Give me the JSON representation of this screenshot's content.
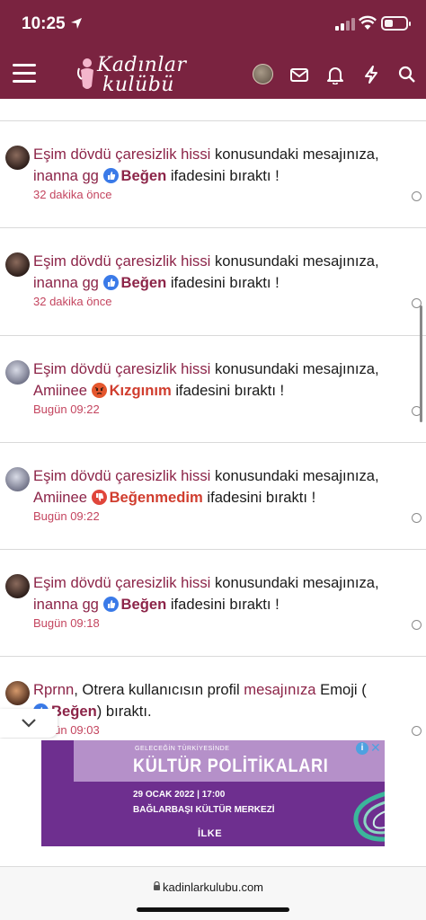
{
  "status_bar": {
    "time": "10:25"
  },
  "header": {
    "logo_line1": "Kadınlar",
    "logo_line2": "kulübü",
    "icons": [
      "menu-icon",
      "user-avatar",
      "mail-icon",
      "bell-icon",
      "bolt-icon",
      "search-icon"
    ],
    "brand_color": "#7a2340"
  },
  "notifications": [
    {
      "thread": "Eşim dövdü çaresizlik hissi",
      "mid": " konusundaki mesajınıza,",
      "user": "inanna gg",
      "reaction": "Beğen",
      "reaction_type": "like",
      "tail": " ifadesini bıraktı !",
      "time": "32 dakika önce"
    },
    {
      "thread": "Eşim dövdü çaresizlik hissi",
      "mid": " konusundaki mesajınıza,",
      "user": "inanna gg",
      "reaction": "Beğen",
      "reaction_type": "like",
      "tail": " ifadesini bıraktı !",
      "time": "32 dakika önce"
    },
    {
      "thread": "Eşim dövdü çaresizlik hissi",
      "mid": " konusundaki mesajınıza,",
      "user": "Amiinee",
      "reaction": "Kızgınım",
      "reaction_type": "angry",
      "tail": " ifadesini bıraktı !",
      "time": "Bugün 09:22"
    },
    {
      "thread": "Eşim dövdü çaresizlik hissi",
      "mid": " konusundaki mesajınıza,",
      "user": "Amiinee",
      "reaction": "Beğenmedim",
      "reaction_type": "dislike",
      "tail": " ifadesini bıraktı !",
      "time": "Bugün 09:22"
    },
    {
      "thread": "Eşim dövdü çaresizlik hissi",
      "mid": " konusundaki mesajınıza,",
      "user": "inanna gg",
      "reaction": "Beğen",
      "reaction_type": "like",
      "tail": " ifadesini bıraktı !",
      "time": "Bugün 09:18"
    }
  ],
  "last_notification": {
    "user": "Rprnn",
    "part1": ", Otrera kullanıcısın profil ",
    "link": "mesajınıza",
    "part2": " Emoji (",
    "reaction": "Beğen",
    "part3": ") bıraktı.",
    "time": "Bugün 09:03"
  },
  "ad": {
    "small": "GELECEĞİN TÜRKİYESİNDE",
    "title": "KÜLTÜR POLİTİKALARI",
    "date": "29 OCAK 2022 | 17:00",
    "place": "BAĞLARBAŞI KÜLTÜR MERKEZİ",
    "logo": "İLKE"
  },
  "url_bar": {
    "url": "kadinlarkulubu.com"
  }
}
